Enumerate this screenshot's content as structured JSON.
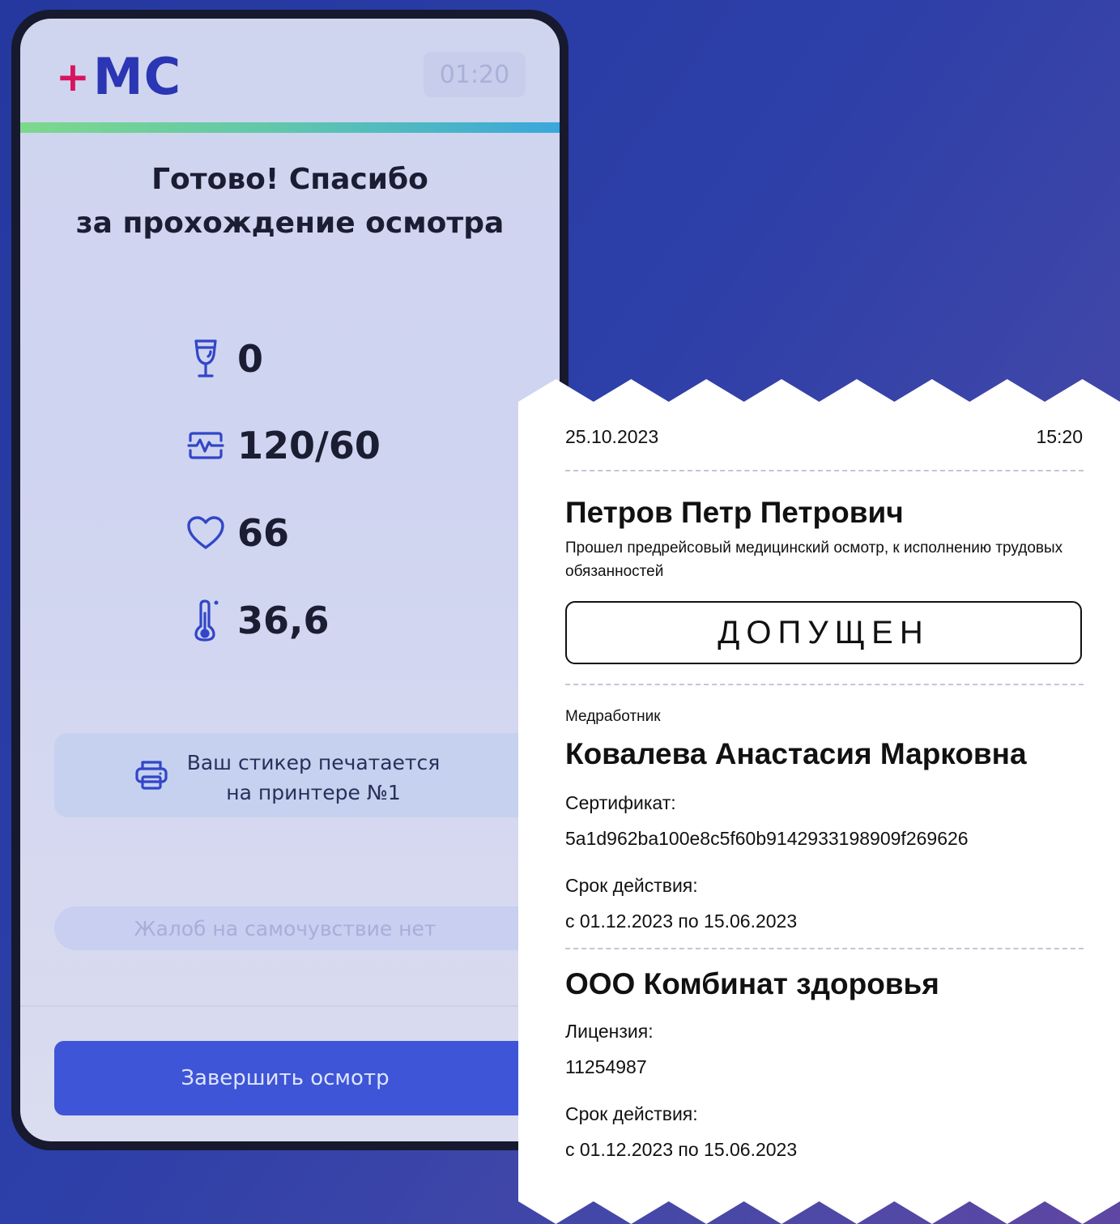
{
  "app": {
    "logo_plus": "+",
    "logo_text": "MC",
    "timer": "01:20",
    "heading_line1": "Готово! Спасибо",
    "heading_line2": "за прохождение осмотра",
    "readings": [
      {
        "icon": "wine-glass-icon",
        "value": "0"
      },
      {
        "icon": "blood-pressure-icon",
        "value": "120/60"
      },
      {
        "icon": "heart-icon",
        "value": "66"
      },
      {
        "icon": "thermometer-icon",
        "value": "36,6"
      }
    ],
    "printer_line1": "Ваш стикер печатается",
    "printer_line2": "на принтере №1",
    "complaints": "Жалоб на самочувствие нет",
    "finish_button": "Завершить осмотр"
  },
  "receipt": {
    "date": "25.10.2023",
    "time": "15:20",
    "patient_name": "Петров Петр Петрович",
    "description": "Прошел предрейсовый медицинский осмотр, к исполнению трудовых обязанностей",
    "status": "ДОПУЩЕН",
    "medic_label": "Медработник",
    "medic_name": "Ковалева Анастасия Марковна",
    "certificate_label": "Сертификат:",
    "certificate": "5a1d962ba100e8c5f60b9142933198909f269626",
    "validity_label": "Срок действия:",
    "certificate_validity": "с 01.12.2023 по 15.06.2023",
    "organization": "ООО Комбинат здоровья",
    "license_label": "Лицензия:",
    "license": "11254987",
    "license_validity_label": "Срок действия:",
    "license_validity": "с 01.12.2023 по 15.06.2023"
  },
  "colors": {
    "brand_blue": "#2a36b4",
    "brand_pink": "#d6155e",
    "button_blue": "#3d55d6",
    "icon_blue": "#3246c8"
  }
}
